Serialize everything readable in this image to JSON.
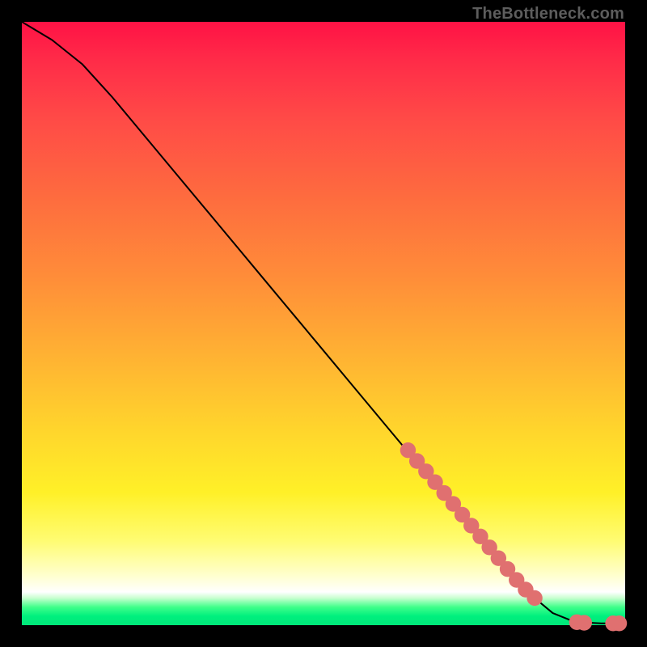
{
  "attribution": "TheBottleneck.com",
  "chart_data": {
    "type": "line",
    "title": "",
    "xlabel": "",
    "ylabel": "",
    "xlim": [
      0,
      100
    ],
    "ylim": [
      0,
      100
    ],
    "series": [
      {
        "name": "curve",
        "x": [
          0,
          5,
          10,
          15,
          20,
          25,
          30,
          35,
          40,
          45,
          50,
          55,
          60,
          65,
          70,
          75,
          80,
          85,
          88,
          91,
          94,
          96,
          98,
          100
        ],
        "y": [
          100,
          97,
          93,
          87.5,
          81.5,
          75.5,
          69.5,
          63.5,
          57.5,
          51.5,
          45.5,
          39.5,
          33.5,
          27.5,
          21.5,
          15.5,
          9.5,
          4.5,
          2.0,
          0.8,
          0.4,
          0.3,
          0.3,
          0.3
        ]
      }
    ],
    "markers": [
      {
        "x": 64.0,
        "y": 29.0
      },
      {
        "x": 65.5,
        "y": 27.2
      },
      {
        "x": 67.0,
        "y": 25.5
      },
      {
        "x": 68.5,
        "y": 23.7
      },
      {
        "x": 70.0,
        "y": 21.9
      },
      {
        "x": 71.5,
        "y": 20.1
      },
      {
        "x": 73.0,
        "y": 18.3
      },
      {
        "x": 74.5,
        "y": 16.5
      },
      {
        "x": 76.0,
        "y": 14.7
      },
      {
        "x": 77.5,
        "y": 12.9
      },
      {
        "x": 79.0,
        "y": 11.1
      },
      {
        "x": 80.5,
        "y": 9.3
      },
      {
        "x": 82.0,
        "y": 7.5
      },
      {
        "x": 83.5,
        "y": 5.9
      },
      {
        "x": 85.0,
        "y": 4.5
      },
      {
        "x": 92.0,
        "y": 0.5
      },
      {
        "x": 93.2,
        "y": 0.4
      },
      {
        "x": 98.0,
        "y": 0.3
      },
      {
        "x": 99.0,
        "y": 0.3
      }
    ],
    "marker_color": "#e07070",
    "marker_radius_pct": 1.3
  }
}
